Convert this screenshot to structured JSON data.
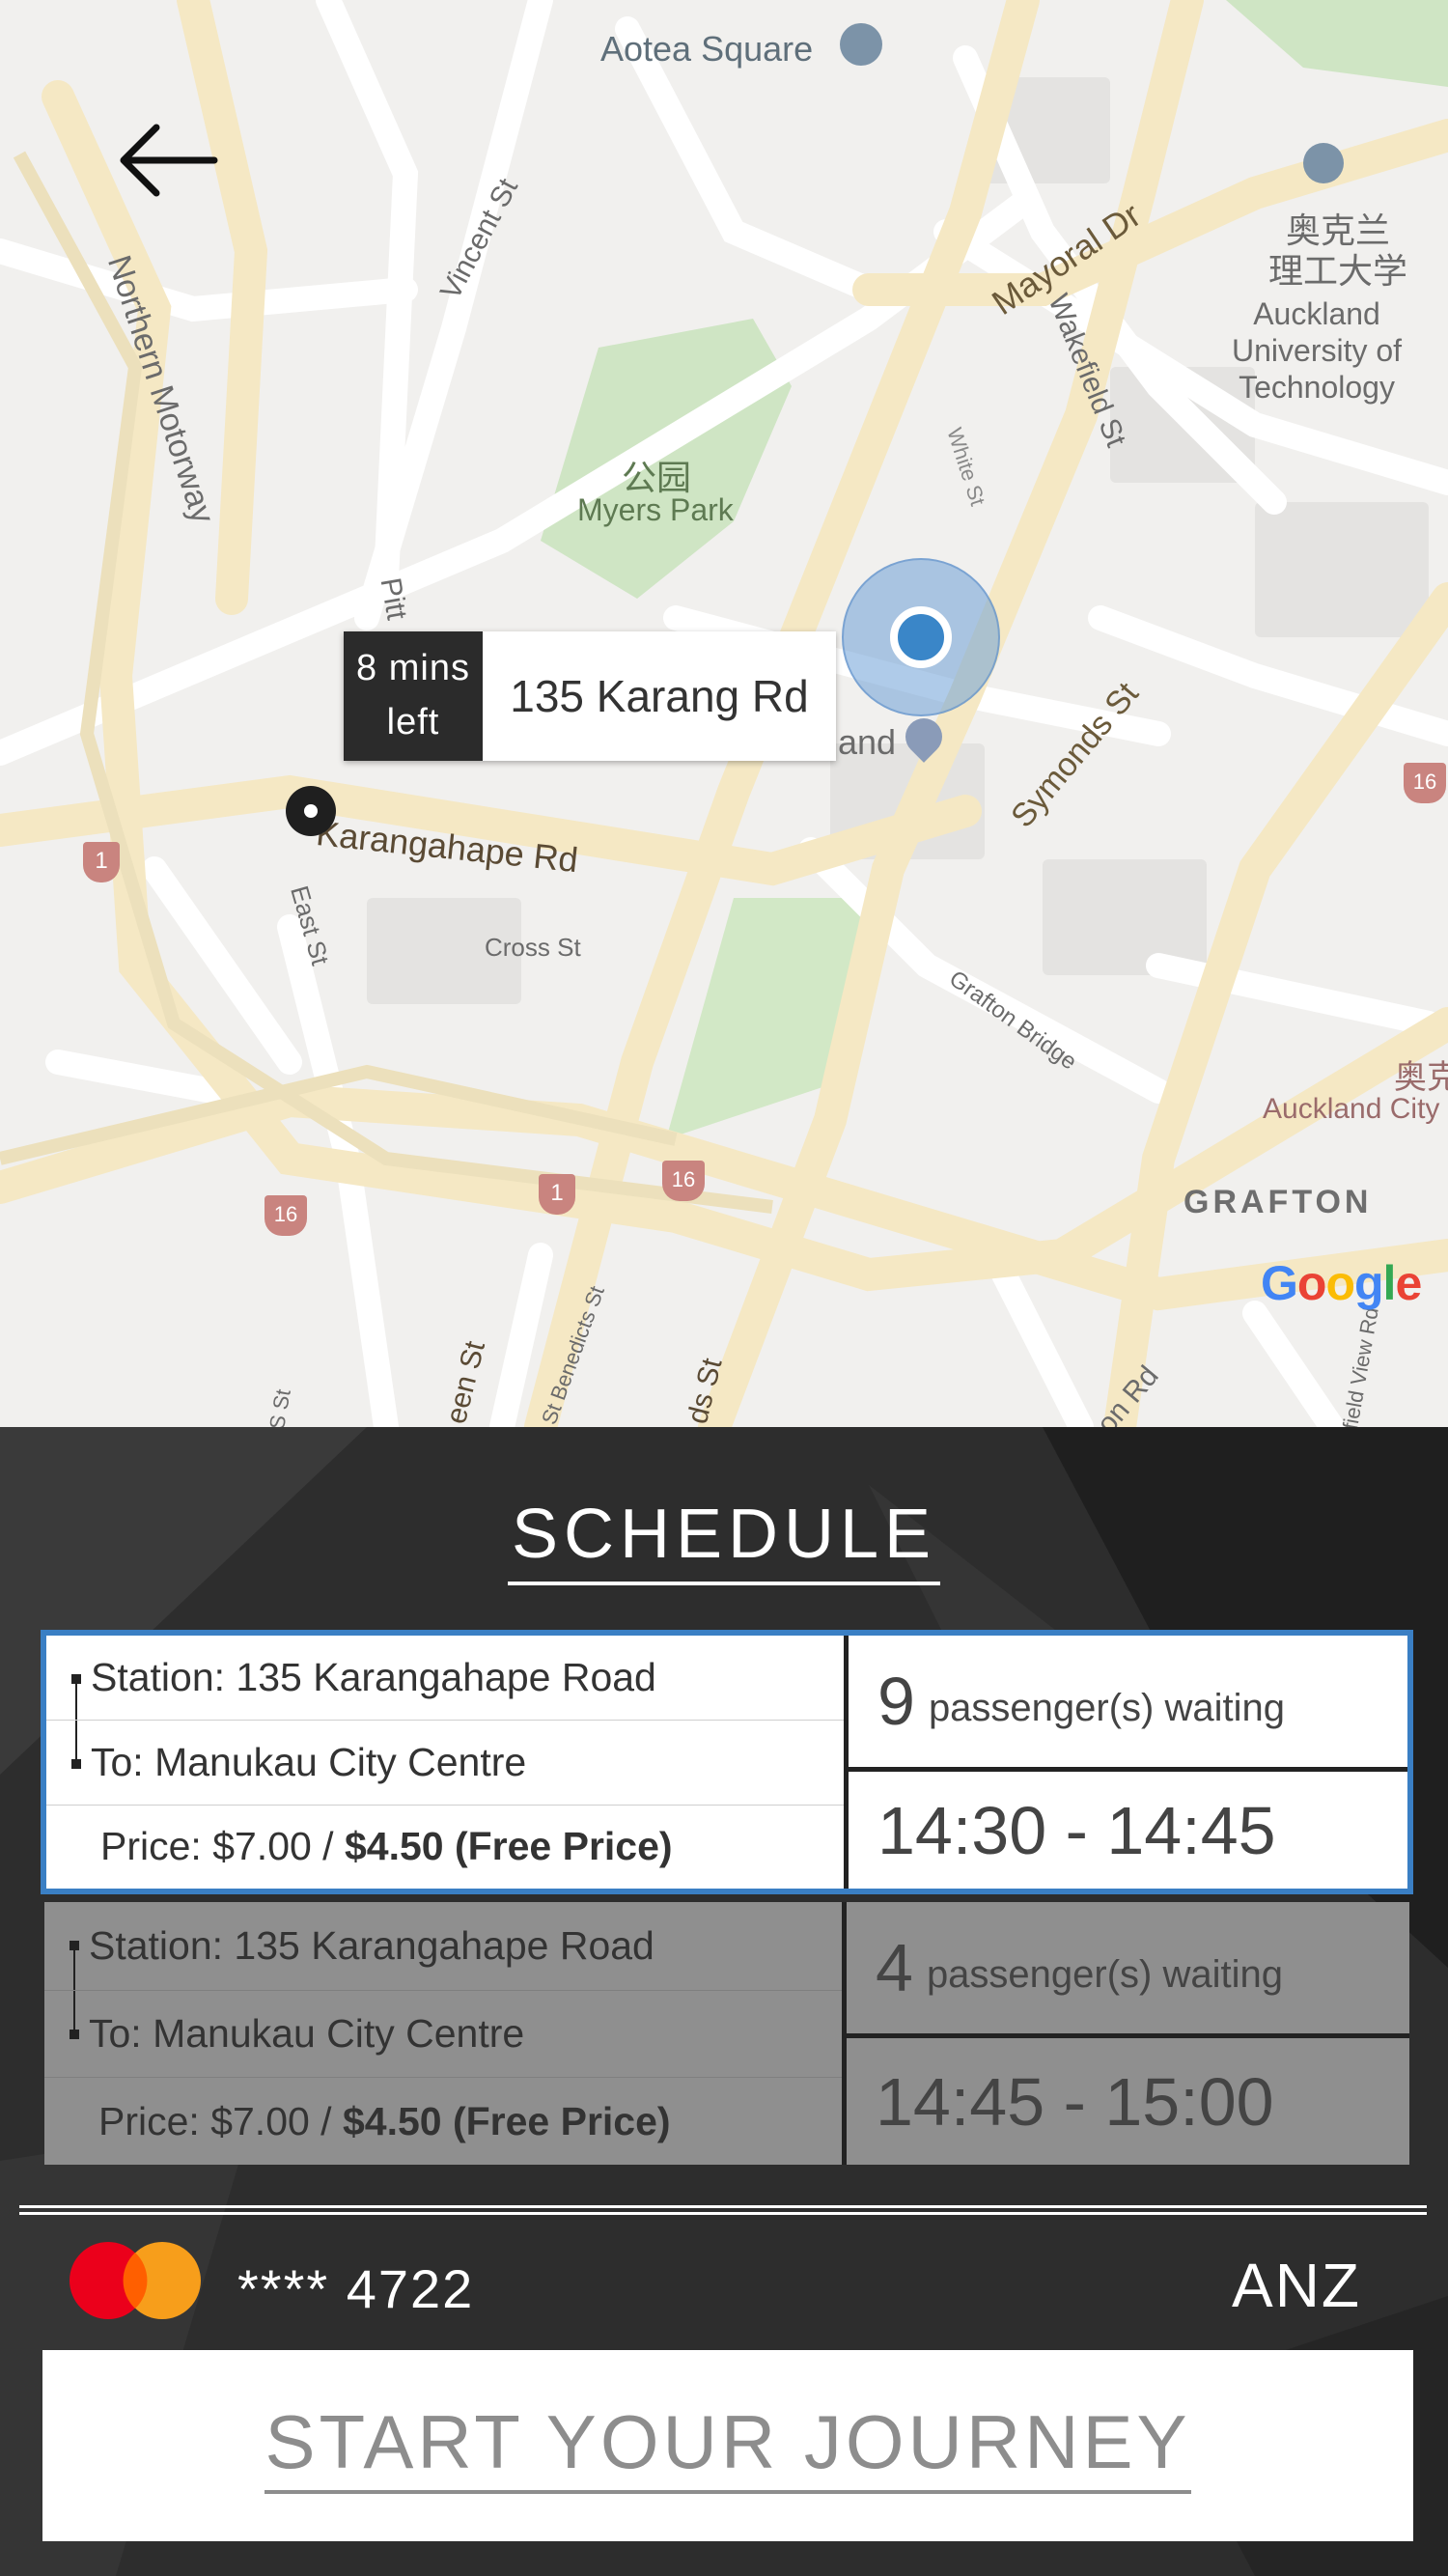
{
  "map": {
    "labels": {
      "aotea": "Aotea Square",
      "northern_motorway": "Northern Motorway",
      "vincent_st": "Vincent St",
      "mayoral_dr": "Mayoral Dr",
      "wakefield_st": "Wakefield St",
      "white_st": "White St",
      "aut_cn": "奥克兰\n理工大学",
      "aut_en": "Auckland\nUniversity of\nTechnology",
      "park_cn": "公园",
      "myers_park": "Myers Park",
      "pitt": "Pitt",
      "land": "and",
      "symonds_st": "Symonds St",
      "karangahape_rd": "Karangahape Rd",
      "east_st": "East St",
      "cross_st": "Cross St",
      "grafton_bridge": "Grafton Bridge",
      "auckland_city_cn": "奥克",
      "auckland_city": "Auckland City",
      "grafton": "GRAFTON",
      "st_benedicts": "St Benedicts St",
      "queen_st": "een St",
      "symonds_lower": "ds St",
      "on_rd": "on Rd",
      "field_view_rd": "field View Rd",
      "s_st": "S St",
      "route_1": "1",
      "route_16": "16"
    },
    "eta": {
      "line1": "8 mins",
      "line2": "left"
    },
    "address": "135 Karang Rd",
    "google": "Google"
  },
  "schedule": {
    "title": "SCHEDULE",
    "items": [
      {
        "station": "Station: 135 Karangahape Road",
        "to": "To: Manukau City Centre",
        "price_prefix": "Price: $7.00 / ",
        "price_free": "$4.50 (Free Price)",
        "passengers": "9",
        "passengers_label": "passenger(s) waiting",
        "time": "14:30 - 14:45",
        "selected": true
      },
      {
        "station": "Station: 135 Karangahape Road",
        "to": "To: Manukau City Centre",
        "price_prefix": "Price: $7.00 / ",
        "price_free": "$4.50 (Free Price)",
        "passengers": "4",
        "passengers_label": "passenger(s) waiting",
        "time": "14:45 - 15:00",
        "selected": false
      }
    ]
  },
  "payment": {
    "card_number": "**** 4722",
    "bank": "ANZ",
    "brand_icon": "mastercard-icon"
  },
  "cta": {
    "label": "START YOUR JOURNEY"
  },
  "colors": {
    "accent": "#3a7fc4",
    "user_dot": "#3a86c8",
    "road": "#f7e9c3"
  }
}
